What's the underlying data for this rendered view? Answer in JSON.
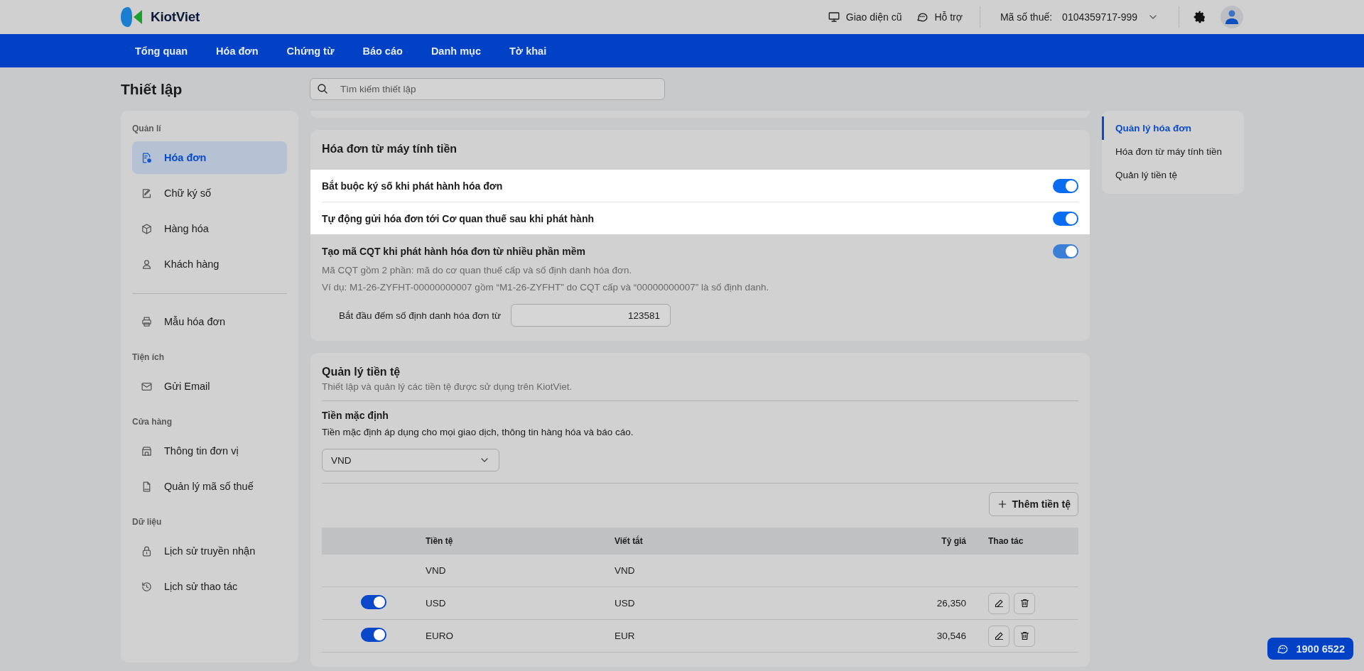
{
  "header": {
    "logo": "KiotViet",
    "links": [
      {
        "label": "Giao diện cũ"
      },
      {
        "label": "Hỗ trợ"
      }
    ],
    "tax_code_label": "Mã số thuế:",
    "tax_code": "0104359717-999"
  },
  "nav": [
    {
      "label": "Tổng quan"
    },
    {
      "label": "Hóa đơn"
    },
    {
      "label": "Chứng từ"
    },
    {
      "label": "Báo cáo"
    },
    {
      "label": "Danh mục"
    },
    {
      "label": "Tờ khai"
    }
  ],
  "page_title": "Thiết lập",
  "search": {
    "placeholder": "Tìm kiếm thiết lập"
  },
  "sidebar": {
    "groups": [
      {
        "title": "Quản lí",
        "items": [
          {
            "label": "Hóa đơn",
            "selected": true
          },
          {
            "label": "Chữ ký số",
            "selected": false
          },
          {
            "label": "Hàng hóa",
            "selected": false
          },
          {
            "label": "Khách hàng",
            "selected": false
          }
        ]
      },
      {
        "items": [
          {
            "label": "Mẫu hóa đơn",
            "selected": false
          }
        ]
      },
      {
        "title": "Tiện ích",
        "items": [
          {
            "label": "Gửi Email",
            "selected": false
          }
        ]
      },
      {
        "title": "Cửa hàng",
        "items": [
          {
            "label": "Thông tin đơn vị",
            "selected": false
          },
          {
            "label": "Quản lý mã số thuế",
            "selected": false
          }
        ]
      },
      {
        "title": "Dữ liệu",
        "items": [
          {
            "label": "Lịch sử truyền nhận",
            "selected": false
          },
          {
            "label": "Lịch sử thao tác",
            "selected": false
          }
        ]
      }
    ]
  },
  "cash_register_card": {
    "title": "Hóa đơn từ máy tính tiền",
    "settings": [
      {
        "label": "Bắt buộc ký số khi phát hành hóa đơn",
        "on": true,
        "highlighted": true
      },
      {
        "label": "Tự động gửi hóa đơn tới Cơ quan thuế sau khi phát hành",
        "on": true,
        "highlighted": true
      },
      {
        "label": "Tạo mã CQT khi phát hành hóa đơn từ nhiều phần mềm",
        "on": true,
        "highlighted": false,
        "description": [
          "Mã CQT gồm 2 phần: mã do cơ quan thuế cấp và số định danh hóa đơn.",
          "Ví dụ: M1-26-ZYFHT-00000000007 gồm “M1-26-ZYFHT” do CQT cấp và “00000000007” là số định danh."
        ],
        "field": {
          "label": "Bắt đầu đếm số định danh hóa đơn từ",
          "value": "123581"
        }
      }
    ]
  },
  "currency_card": {
    "title": "Quản lý tiền tệ",
    "subtitle": "Thiết lập và quản lý các tiền tệ được sử dụng trên KiotViet.",
    "default_title": "Tiền mặc định",
    "default_description": "Tiền mặc định áp dụng cho mọi giao dịch, thông tin hàng hóa và báo cáo.",
    "default_value": "VND",
    "add_button": "Thêm tiền tệ",
    "columns": [
      "Tiền tệ",
      "Viết tắt",
      "Tỷ giá",
      "Thao tác"
    ],
    "rows": [
      {
        "kind": "base",
        "currency": "VND",
        "code": "VND"
      },
      {
        "kind": "custom",
        "on": true,
        "currency": "USD",
        "code": "USD",
        "rate": "26,350"
      },
      {
        "kind": "custom",
        "on": true,
        "currency": "EURO",
        "code": "EUR",
        "rate": "30,546"
      }
    ]
  },
  "toc": [
    {
      "label": "Quản lý hóa đơn",
      "selected": true
    },
    {
      "label": "Hóa đơn từ máy tính tiền",
      "selected": false
    },
    {
      "label": "Quản lý tiền tệ",
      "selected": false
    }
  ],
  "hotline": "1900 6522"
}
